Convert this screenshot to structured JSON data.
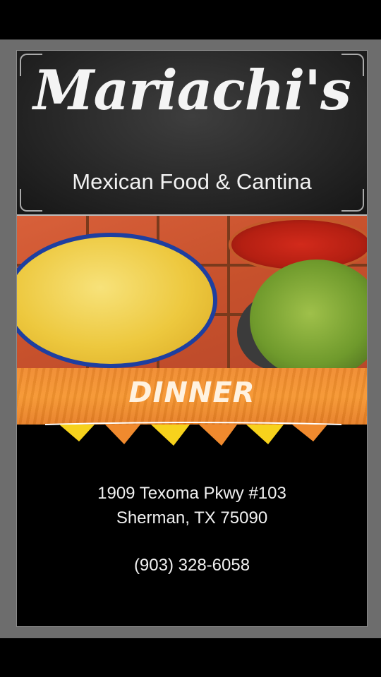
{
  "brand": {
    "name": "Mariachi's",
    "tagline": "Mexican Food & Cantina"
  },
  "banner": {
    "label": "DINNER"
  },
  "contact": {
    "address_line1": "1909 Texoma Pkwy #103",
    "address_line2": "Sherman, TX 75090",
    "phone": "(903) 328-6058"
  },
  "colors": {
    "chalkboard": "#262626",
    "banner_orange": "#f6962f",
    "flag_yellow": "#f7d21c",
    "flag_orange": "#f08a2e",
    "background": "#000000",
    "frame": "#6d6d6d"
  }
}
